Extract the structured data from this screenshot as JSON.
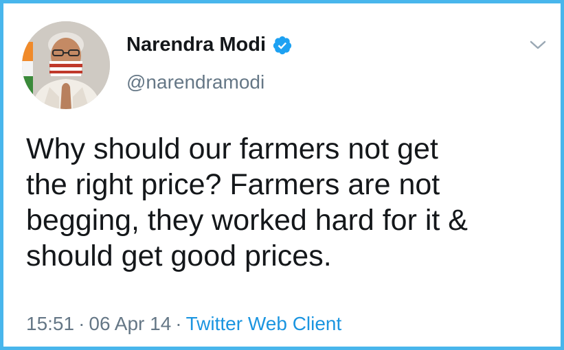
{
  "tweet": {
    "author": {
      "display_name": "Narendra Modi",
      "handle": "@narendramodi",
      "verified": true,
      "avatar_icon": "profile-photo-icon"
    },
    "text_lines": [
      "Why should our farmers not get",
      "the right price? Farmers are not",
      "begging, they worked hard for it &",
      "should get good prices."
    ],
    "time": "15:51",
    "separator": "·",
    "date": "06 Apr 14",
    "source": "Twitter Web Client"
  },
  "icons": {
    "verified": "verified-badge-icon",
    "menu": "chevron-down-icon"
  },
  "colors": {
    "border": "#48b6ec",
    "verified_badge": "#1da1f2",
    "link": "#1b95e0",
    "secondary_text": "#657786",
    "primary_text": "#14171a"
  }
}
